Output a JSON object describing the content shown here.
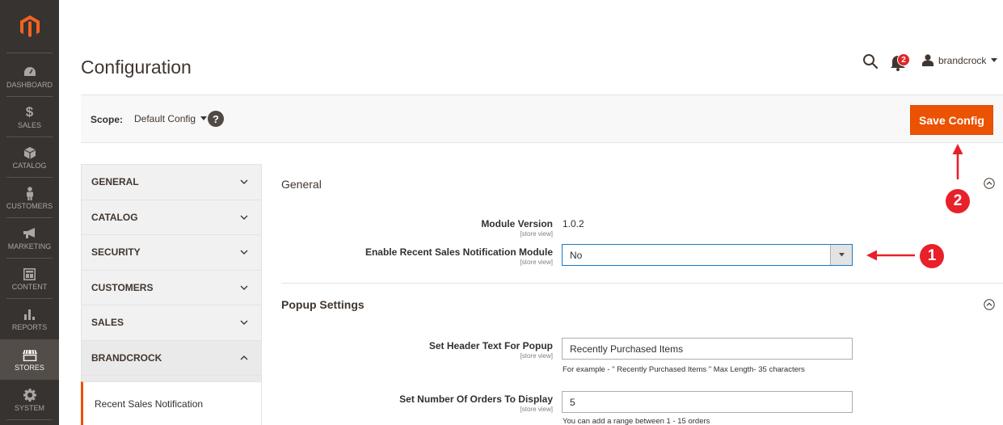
{
  "nav": {
    "items": [
      {
        "label": "Dashboard",
        "icon": "dashboard-icon"
      },
      {
        "label": "Sales",
        "icon": "dollar-icon"
      },
      {
        "label": "Catalog",
        "icon": "box-icon"
      },
      {
        "label": "Customers",
        "icon": "person-icon"
      },
      {
        "label": "Marketing",
        "icon": "megaphone-icon"
      },
      {
        "label": "Content",
        "icon": "content-icon"
      },
      {
        "label": "Reports",
        "icon": "bar-chart-icon"
      },
      {
        "label": "Stores",
        "icon": "store-icon"
      },
      {
        "label": "System",
        "icon": "gear-icon"
      }
    ],
    "active": "Stores"
  },
  "header": {
    "title": "Configuration",
    "notifications_count": "2",
    "username": "brandcrock"
  },
  "scope": {
    "label": "Scope:",
    "value": "Default Config",
    "help": "?"
  },
  "save_button": "Save Config",
  "tabs": [
    {
      "label": "GENERAL",
      "open": false
    },
    {
      "label": "CATALOG",
      "open": false
    },
    {
      "label": "SECURITY",
      "open": false
    },
    {
      "label": "CUSTOMERS",
      "open": false
    },
    {
      "label": "SALES",
      "open": false
    },
    {
      "label": "BRANDCROCK",
      "open": true
    }
  ],
  "subtab": "Recent Sales Notification",
  "sections": {
    "general": {
      "title": "General",
      "module_version_label": "Module Version",
      "module_version_scope": "[store view]",
      "module_version_value": "1.0.2",
      "enable_label": "Enable Recent Sales Notification Module",
      "enable_scope": "[store view]",
      "enable_value": "No"
    },
    "popup": {
      "title": "Popup Settings",
      "header_text_label": "Set Header Text For Popup",
      "header_text_scope": "[store view]",
      "header_text_value": "Recently Purchased Items",
      "header_text_note": "For example - \" Recently Purchased Items \" Max Length- 35 characters",
      "orders_label": "Set Number Of Orders To Display",
      "orders_scope": "[store view]",
      "orders_value": "5",
      "orders_note": "You can add a range between 1 - 15 orders"
    }
  },
  "callouts": [
    "1",
    "2"
  ],
  "colors": {
    "accent": "#eb5202",
    "nav_bg": "#373330",
    "callout": "#e8202a"
  }
}
